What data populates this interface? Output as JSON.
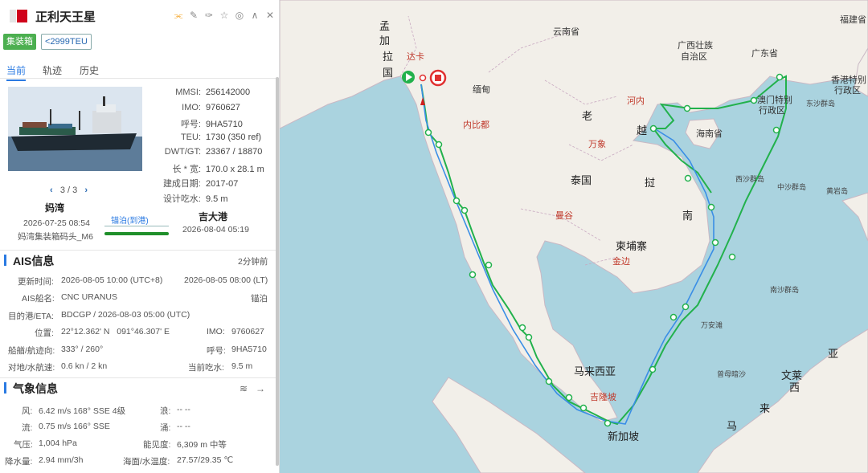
{
  "header": {
    "ship_name": "正利天王星",
    "tag_type": "集装箱",
    "tag_size": "<2999TEU",
    "icons": [
      "share-icon",
      "edit-icon",
      "tag-icon",
      "star-icon",
      "location-icon",
      "collapse-icon",
      "close-icon"
    ]
  },
  "tabs": [
    {
      "label": "当前",
      "active": true
    },
    {
      "label": "轨迹",
      "active": false
    },
    {
      "label": "历史",
      "active": false
    }
  ],
  "photo": {
    "pager": "3 / 3"
  },
  "specs": [
    {
      "k": "MMSI:",
      "v": "256142000"
    },
    {
      "k": "IMO:",
      "v": "9760627"
    },
    {
      "k": "呼号:",
      "v": "9HA5710"
    },
    {
      "k": "TEU:",
      "v": "1730 (350 ref)"
    },
    {
      "k": "DWT/GT:",
      "v": "23367 / 18870"
    },
    {
      "k": "长 * 宽:",
      "v": "170.0 x 28.1 m"
    },
    {
      "k": "建成日期:",
      "v": "2017-07"
    },
    {
      "k": "设计吃水:",
      "v": "9.5 m"
    }
  ],
  "voyage": {
    "from_port": "妈湾",
    "from_time": "2026-07-25 08:54",
    "from_berth": "妈湾集装箱码头_M6",
    "status": "锚泊(到港)",
    "progress": 1.0,
    "to_port": "吉大港",
    "to_time": "2026-08-04 05:19"
  },
  "ais": {
    "title": "AIS信息",
    "ago": "2分钟前",
    "update_label": "更新时间:",
    "update_utc": "2026-08-05 10:00 (UTC+8)",
    "update_lt": "2026-08-05 08:00 (LT)",
    "name_label": "AIS船名:",
    "name": "CNC URANUS",
    "nav_status": "锚泊",
    "dest_label": "目的港/ETA:",
    "dest": "BDCGP / 2026-08-03 05:00 (UTC)",
    "pos_label": "位置:",
    "pos": "22°12.362' N   091°46.307' E",
    "imo_label": "IMO:",
    "imo": "9760627",
    "heading_label": "船艏/航迹向:",
    "heading": "333° / 260°",
    "callsign_label": "呼号:",
    "callsign": "9HA5710",
    "speed_label": "对地/水航速:",
    "speed": "0.6 kn / 2 kn",
    "draught_label": "当前吃水:",
    "draught": "9.5 m"
  },
  "weather": {
    "title": "气象信息",
    "wind_label": "风:",
    "wind": "6.42 m/s 168° SSE 4级",
    "wave_label": "浪:",
    "wave": "-- --",
    "current_label": "流:",
    "current": "0.75 m/s 166° SSE",
    "swell_label": "涌:",
    "swell": "-- --",
    "pressure_label": "气压:",
    "pressure": "1,004 hPa",
    "visibility_label": "能见度:",
    "visibility": "6,309 m 中等",
    "rain_label": "降水量:",
    "rain": "2.94 mm/3h",
    "temp_label": "海面/水温度:",
    "temp": "27.57/29.35 ℃"
  },
  "map": {
    "labels": {
      "bangladesh_1": "孟",
      "bangladesh_2": "加",
      "bangladesh_3": "拉",
      "bangladesh_4": "国",
      "dhaka": "达卡",
      "myanmar": "缅甸",
      "naypyidaw": "内比都",
      "yunnan": "云南省",
      "guangxi_1": "广西壮族",
      "guangxi_2": "自治区",
      "guangdong": "广东省",
      "fujian": "福建省",
      "hk_1": "香港特别",
      "hk_2": "行政区",
      "macau_1": "澳门特别",
      "macau_2": "行政区",
      "dongsha": "东沙群岛",
      "hanoi": "河内",
      "laos": "老",
      "vietnam_1": "越",
      "vietnam_2": "南",
      "hainan": "海南省",
      "vientiane": "万象",
      "thailand": "泰国",
      "laos_2": "挝",
      "xisha": "西沙群岛",
      "zhongsha": "中沙群岛",
      "huangyan": "黄岩岛",
      "bangkok": "曼谷",
      "cambodia": "柬埔寨",
      "phnompenh": "金边",
      "nansha": "南沙群岛",
      "wanan": "万安滩",
      "malaysia": "马来西亚",
      "kl": "吉隆坡",
      "singapore": "新加坡",
      "zengmu": "曾母暗沙",
      "brunei_1": "文莱",
      "asia": "亚",
      "xi": "西",
      "lai": "来",
      "ma": "马"
    }
  },
  "colors": {
    "accent": "#2a7ae2",
    "green": "#2e9b3a",
    "route_green": "#22b14c",
    "route_blue": "#3a8ee6",
    "land": "#f2efe9",
    "sea": "#aad3df"
  }
}
